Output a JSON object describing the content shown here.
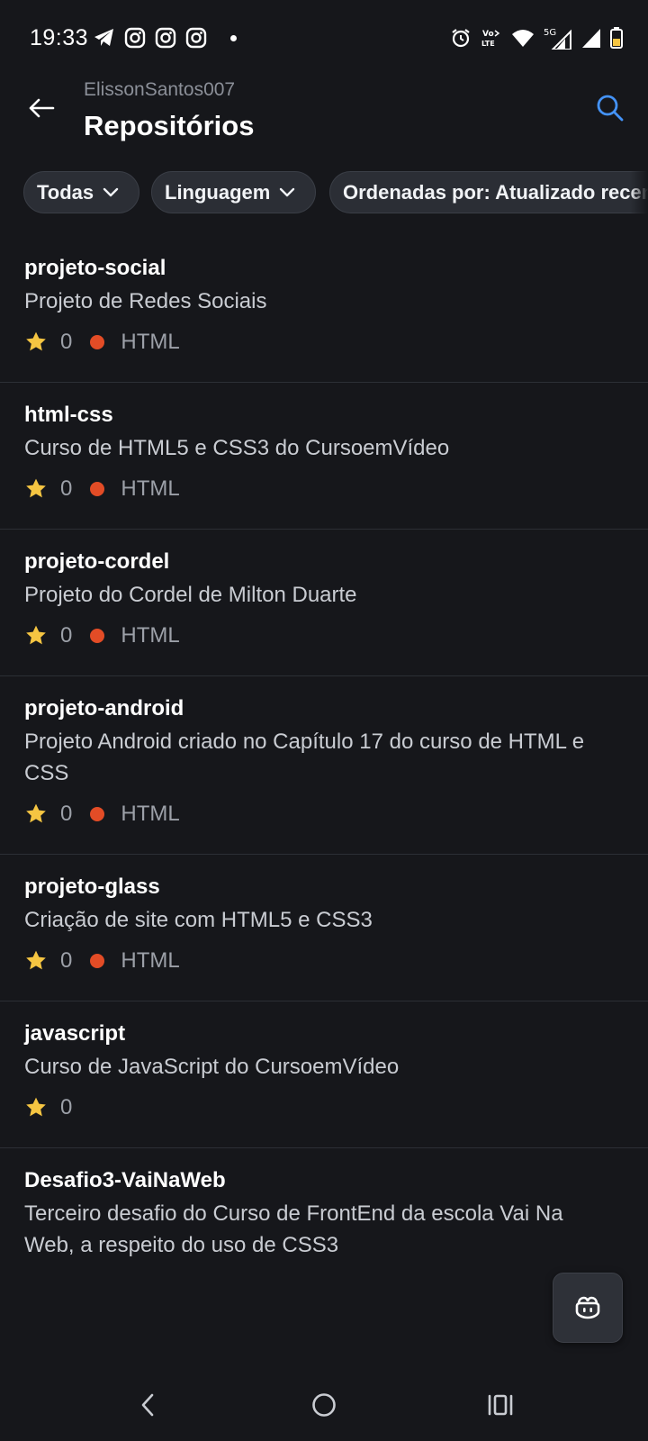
{
  "status_bar": {
    "time": "19:33",
    "left_icons": [
      "telegram-icon",
      "instagram-icon",
      "instagram-icon",
      "instagram-icon",
      "notification-dot"
    ],
    "right_icons": [
      "alarm-icon",
      "volte-icon",
      "wifi-icon",
      "signal-5g-icon",
      "signal-icon",
      "battery-icon"
    ],
    "volte_label": "Vo LTE",
    "network_label": "5G"
  },
  "header": {
    "owner": "ElissonSantos007",
    "title": "Repositórios"
  },
  "filters": {
    "type_label": "Todas",
    "language_label": "Linguagem",
    "sort_label": "Ordenadas por: Atualizado recentemente"
  },
  "colors": {
    "background": "#16171b",
    "html_language": "#e34c26",
    "star": "#f5c542",
    "accent": "#4493f8"
  },
  "repos": [
    {
      "name": "projeto-social",
      "description": "Projeto de Redes Sociais",
      "stars": "0",
      "language": "HTML"
    },
    {
      "name": "html-css",
      "description": "Curso de HTML5 e CSS3 do CursoemVídeo",
      "stars": "0",
      "language": "HTML"
    },
    {
      "name": "projeto-cordel",
      "description": "Projeto do Cordel de Milton Duarte",
      "stars": "0",
      "language": "HTML"
    },
    {
      "name": "projeto-android",
      "description": "Projeto Android criado no Capítulo 17 do curso de HTML e CSS",
      "stars": "0",
      "language": "HTML"
    },
    {
      "name": "projeto-glass",
      "description": "Criação de site com HTML5 e CSS3",
      "stars": "0",
      "language": "HTML"
    },
    {
      "name": "javascript",
      "description": "Curso de JavaScript do CursoemVídeo",
      "stars": "0",
      "language": ""
    },
    {
      "name": "Desafio3-VaiNaWeb",
      "description": "Terceiro desafio do Curso de FrontEnd da escola Vai Na Web, a respeito do uso de CSS3",
      "stars": "",
      "language": ""
    }
  ],
  "fab_icon": "copilot-icon",
  "nav_icons": [
    "back-icon",
    "home-icon",
    "recents-icon"
  ]
}
